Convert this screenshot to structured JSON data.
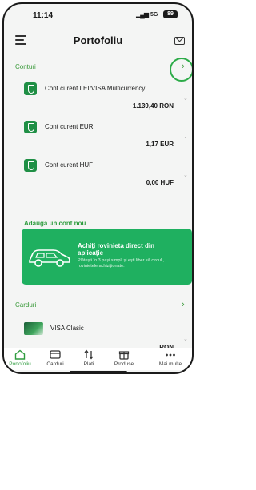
{
  "status_bar": {
    "time": "11:14",
    "signal_icon": "signal-bars-icon",
    "network": "5G",
    "battery": "89"
  },
  "header": {
    "title": "Portofoliu",
    "menu_icon": "hamburger-menu-icon",
    "mail_icon": "mail-icon"
  },
  "accounts_section": {
    "label": "Conturi",
    "chevron": "›",
    "accounts": [
      {
        "name": "Cont curent LEI/VISA Multicurrency",
        "balance": "1.139,40 RON",
        "icon": "shield-icon"
      },
      {
        "name": "Cont curent EUR",
        "balance": "1,17 EUR",
        "icon": "shield-icon"
      },
      {
        "name": "Cont curent HUF",
        "balance": "0,00 HUF",
        "icon": "shield-icon"
      }
    ],
    "add_link": "Adauga un cont nou"
  },
  "banner": {
    "title": "Achiți rovinieta direct din aplicație",
    "subtitle": "Plătești în 3 pași simpli și ești liber să circuli, rovinietele achiziționate.",
    "icon": "car-icon"
  },
  "cards_section": {
    "label": "Carduri",
    "chevron": "›",
    "cards": [
      {
        "name": "VISA Clasic",
        "balance": "RON"
      }
    ]
  },
  "tab_bar": {
    "tabs": [
      {
        "label": "Portofoliu",
        "icon": "home-icon",
        "active": true
      },
      {
        "label": "Carduri",
        "icon": "card-icon",
        "active": false
      },
      {
        "label": "Plati",
        "icon": "transfer-arrows-icon",
        "active": false
      },
      {
        "label": "Produse",
        "icon": "gift-icon",
        "active": false
      },
      {
        "label": "Mai multe",
        "icon": "more-dots-icon",
        "active": false
      }
    ]
  },
  "colors": {
    "accent": "#2e9c3e",
    "banner": "#1fb060",
    "highlight_ring": "#2cab48"
  }
}
